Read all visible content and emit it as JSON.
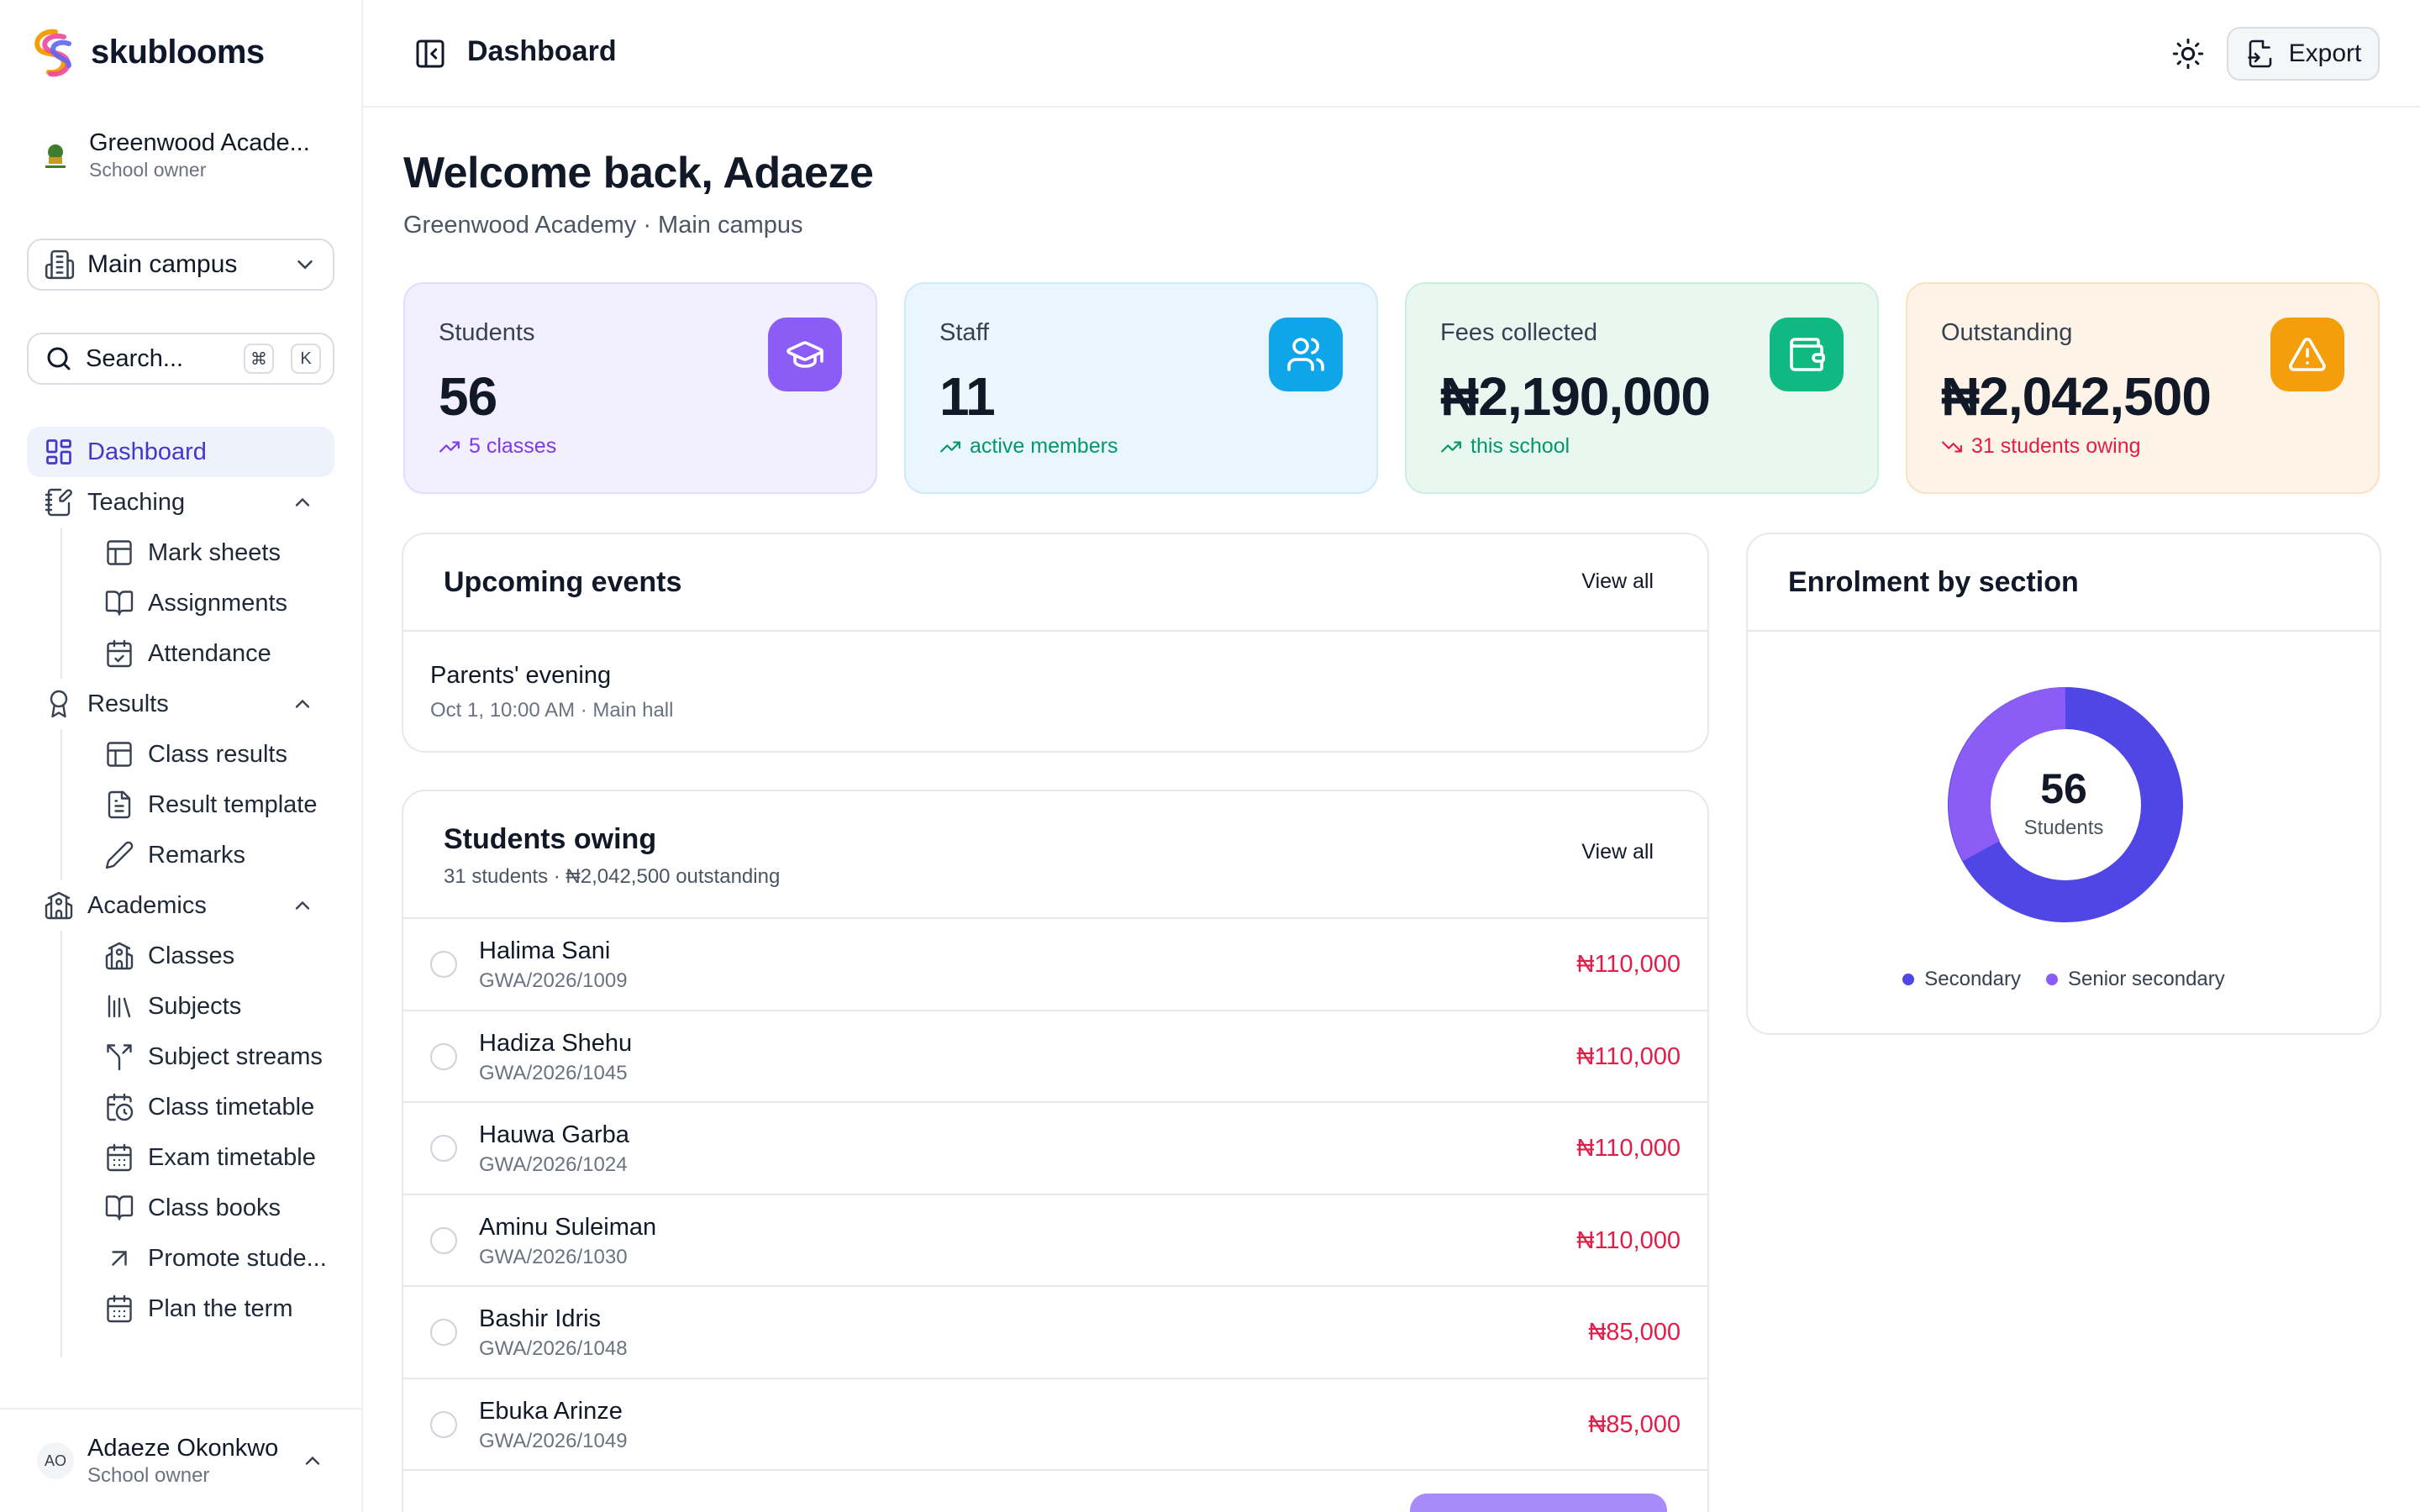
{
  "brand": {
    "name": "skublooms"
  },
  "school": {
    "name": "Greenwood Acade...",
    "role": "School owner"
  },
  "campus": {
    "label": "Main campus"
  },
  "search": {
    "placeholder": "Search...",
    "key1": "⌘",
    "key2": "K"
  },
  "nav": {
    "dashboard": "Dashboard",
    "teaching": {
      "label": "Teaching",
      "items": [
        "Mark sheets",
        "Assignments",
        "Attendance"
      ]
    },
    "results": {
      "label": "Results",
      "items": [
        "Class results",
        "Result template",
        "Remarks"
      ]
    },
    "academics": {
      "label": "Academics",
      "items": [
        "Classes",
        "Subjects",
        "Subject streams",
        "Class timetable",
        "Exam timetable",
        "Class books",
        "Promote stude...",
        "Plan the term"
      ]
    }
  },
  "user": {
    "initials": "AO",
    "name": "Adaeze Okonkwo",
    "role": "School owner"
  },
  "header": {
    "title": "Dashboard",
    "export_label": "Export"
  },
  "welcome": {
    "title": "Welcome back, Adaeze",
    "subtitle": "Greenwood Academy · Main campus"
  },
  "stats": [
    {
      "label": "Students",
      "value": "56",
      "trend": "5 classes",
      "icon": "graduation-cap-icon",
      "color": "#8b5cf6"
    },
    {
      "label": "Staff",
      "value": "11",
      "trend": "active members",
      "icon": "users-icon",
      "color": "#0ea5e9"
    },
    {
      "label": "Fees collected",
      "value": "₦2,190,000",
      "trend": "this school",
      "icon": "wallet-icon",
      "color": "#10b981"
    },
    {
      "label": "Outstanding",
      "value": "₦2,042,500",
      "trend": "31 students owing",
      "icon": "alert-triangle-icon",
      "color": "#f59e0b"
    }
  ],
  "events": {
    "title": "Upcoming events",
    "view_all": "View all",
    "items": [
      {
        "name": "Parents' evening",
        "meta": "Oct 1, 10:00 AM · Main hall"
      }
    ]
  },
  "owing": {
    "title": "Students owing",
    "subtitle": "31 students · ₦2,042,500 outstanding",
    "view_all": "View all",
    "rows": [
      {
        "name": "Halima Sani",
        "id": "GWA/2026/1009",
        "amount": "₦110,000"
      },
      {
        "name": "Hadiza Shehu",
        "id": "GWA/2026/1045",
        "amount": "₦110,000"
      },
      {
        "name": "Hauwa Garba",
        "id": "GWA/2026/1024",
        "amount": "₦110,000"
      },
      {
        "name": "Aminu Suleiman",
        "id": "GWA/2026/1030",
        "amount": "₦110,000"
      },
      {
        "name": "Bashir Idris",
        "id": "GWA/2026/1048",
        "amount": "₦85,000"
      },
      {
        "name": "Ebuka Arinze",
        "id": "GWA/2026/1049",
        "amount": "₦85,000"
      }
    ]
  },
  "enrolment": {
    "title": "Enrolment by section",
    "total": "56",
    "total_label": "Students",
    "colors": {
      "secondary": "#4f46e5",
      "senior_secondary": "#8b5cf6"
    },
    "legend": [
      "Secondary",
      "Senior secondary"
    ]
  }
}
